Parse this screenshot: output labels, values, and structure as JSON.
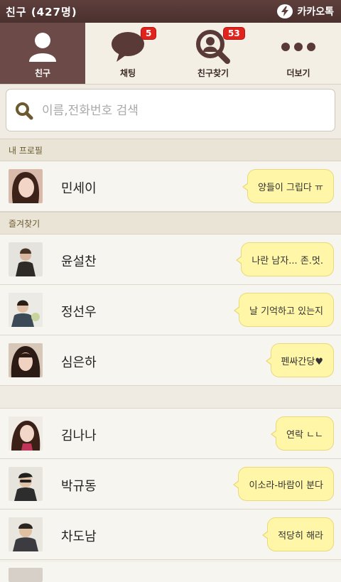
{
  "header": {
    "title": "친구 (427명)",
    "brand": "카카오톡"
  },
  "tabs": [
    {
      "label": "친구",
      "icon": "person-icon",
      "active": true
    },
    {
      "label": "채팅",
      "icon": "chat-bubble-icon",
      "badge": "5"
    },
    {
      "label": "친구찾기",
      "icon": "friend-search-icon",
      "badge": "53"
    },
    {
      "label": "더보기",
      "icon": "more-dots-icon"
    }
  ],
  "search": {
    "placeholder": "이름,전화번호 검색",
    "icon": "search-icon"
  },
  "sections": {
    "my_profile": "내 프로필",
    "favorites": "즐겨찾기"
  },
  "my_profile": {
    "name": "민세이",
    "status": "양들이 그립다 ㅠ"
  },
  "favorites": [
    {
      "name": "윤설찬",
      "status": "나란 남자... 존.멋."
    },
    {
      "name": "정선우",
      "status": "날 기억하고 있는지"
    },
    {
      "name": "심은하",
      "status": "펜싸간당♥"
    }
  ],
  "friends": [
    {
      "name": "김나나",
      "status": "연락 ㄴㄴ"
    },
    {
      "name": "박규동",
      "status": "이소라-바람이 분다"
    },
    {
      "name": "차도남",
      "status": "적당히 해라"
    }
  ],
  "colors": {
    "topbar": "#4a302e",
    "active_tab": "#6b4a47",
    "badge": "#e0231c",
    "bubble": "#fff6a8",
    "section_text": "#6b5a2f"
  }
}
